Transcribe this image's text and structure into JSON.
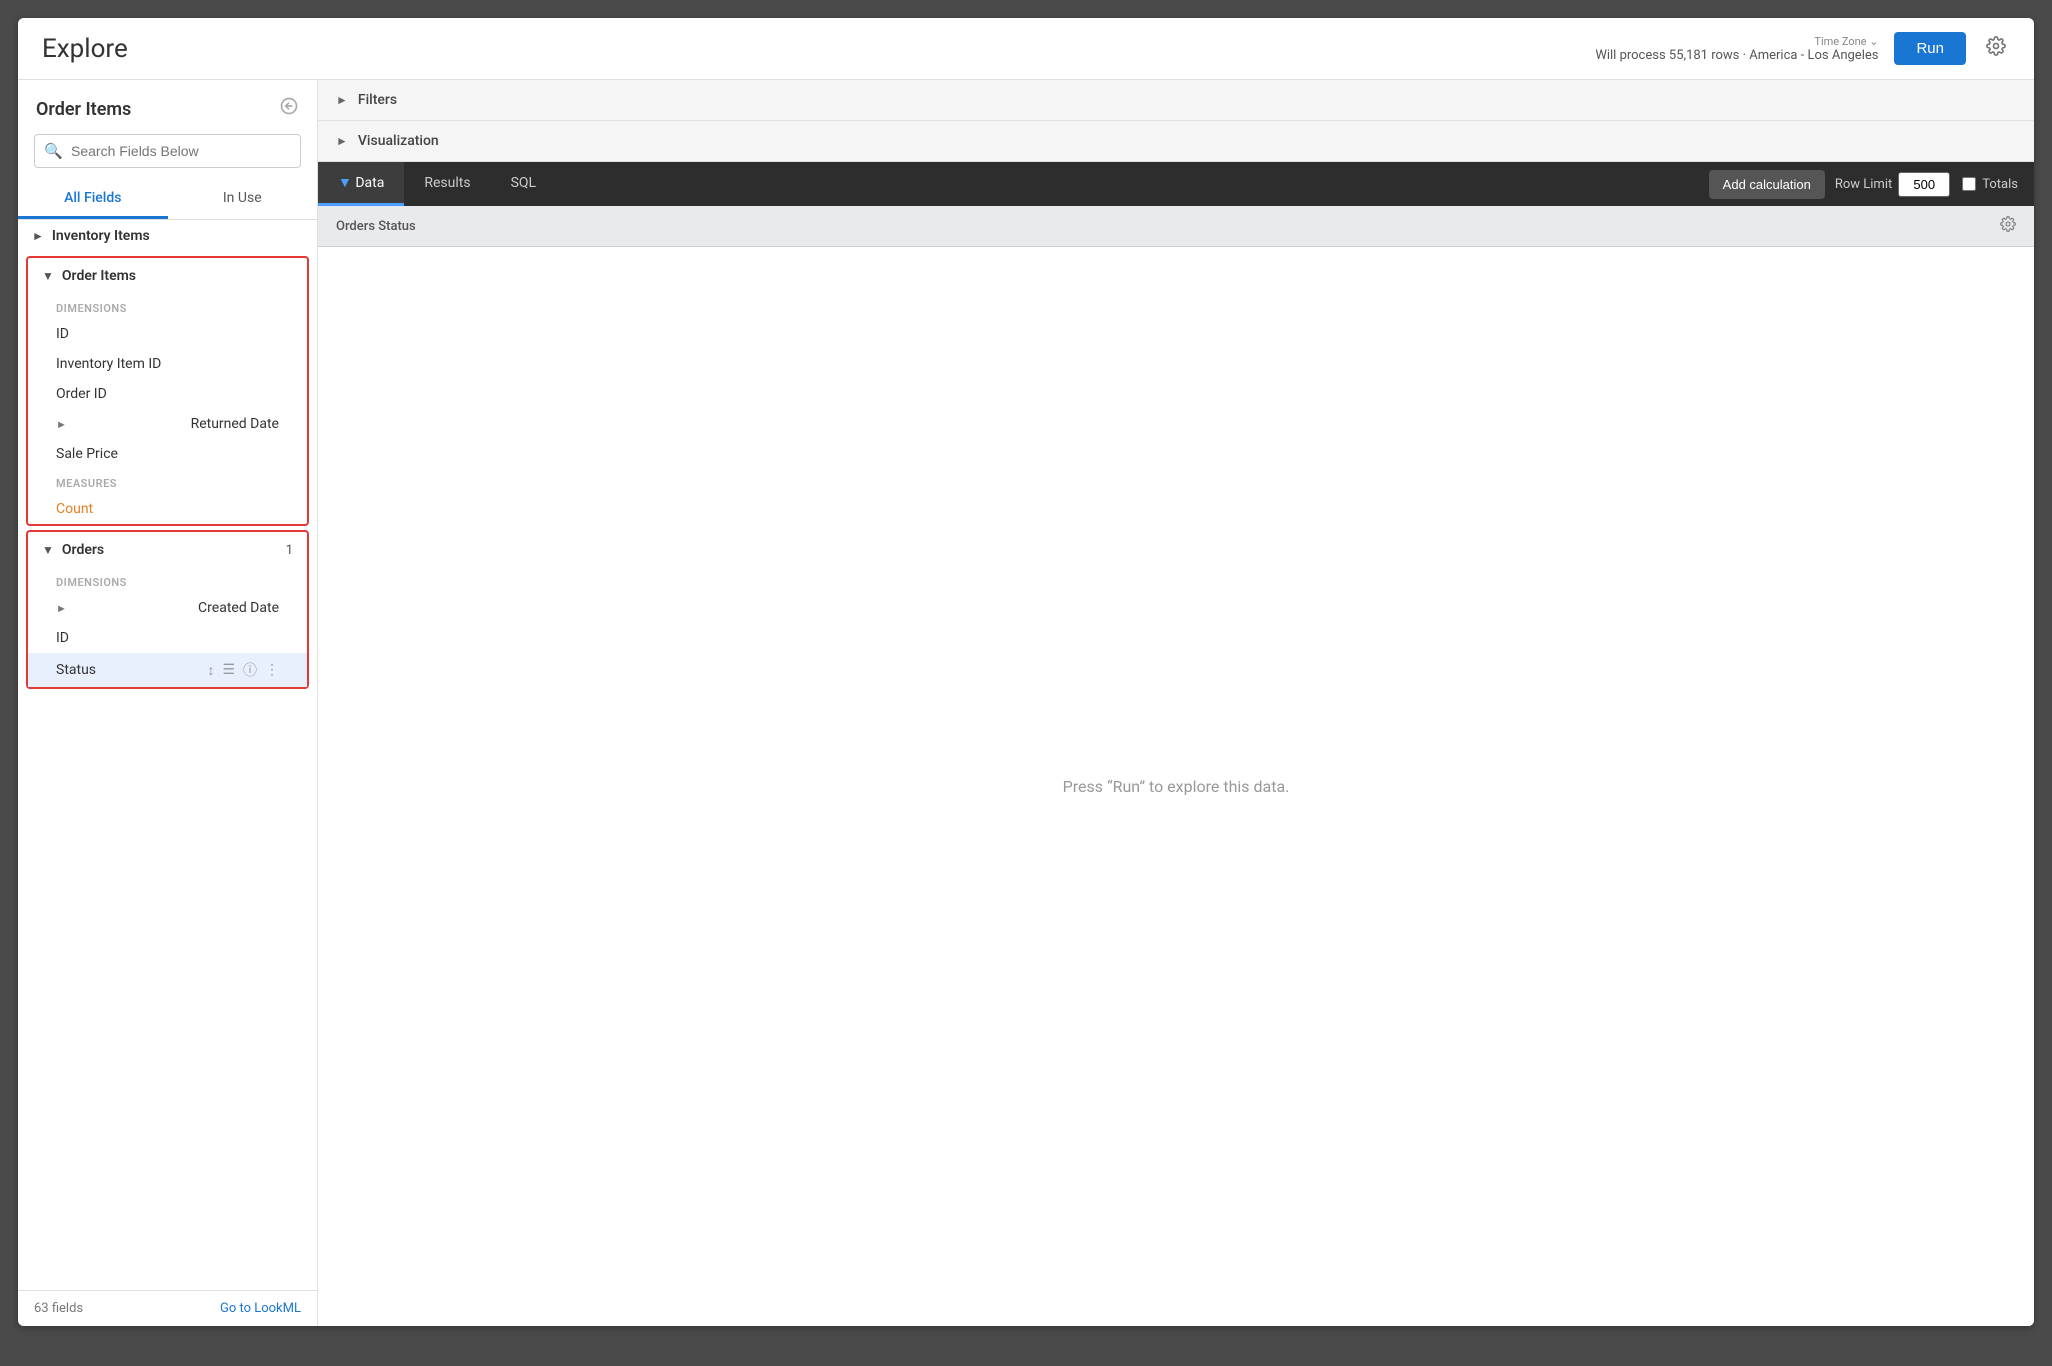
{
  "header": {
    "title": "Explore",
    "timezone_label": "Time Zone",
    "process_info": "Will process 55,181 rows · America - Los Angeles",
    "run_button_label": "Run"
  },
  "sidebar": {
    "title": "Order Items",
    "search_placeholder": "Search Fields Below",
    "tabs": [
      {
        "id": "all-fields",
        "label": "All Fields",
        "active": true
      },
      {
        "id": "in-use",
        "label": "In Use",
        "active": false
      }
    ],
    "groups": [
      {
        "id": "inventory-items",
        "label": "Inventory Items",
        "expanded": false,
        "highlighted": false,
        "count": null,
        "sections": []
      },
      {
        "id": "order-items",
        "label": "Order Items",
        "expanded": true,
        "highlighted": true,
        "count": null,
        "sections": [
          {
            "type": "dimensions",
            "label": "DIMENSIONS",
            "fields": [
              {
                "name": "ID",
                "expandable": false,
                "measure": false
              },
              {
                "name": "Inventory Item ID",
                "expandable": false,
                "measure": false
              },
              {
                "name": "Order ID",
                "expandable": false,
                "measure": false
              },
              {
                "name": "Returned Date",
                "expandable": true,
                "measure": false
              },
              {
                "name": "Sale Price",
                "expandable": false,
                "measure": false
              }
            ]
          },
          {
            "type": "measures",
            "label": "MEASURES",
            "fields": [
              {
                "name": "Count",
                "expandable": false,
                "measure": true
              }
            ]
          }
        ]
      },
      {
        "id": "orders",
        "label": "Orders",
        "expanded": true,
        "highlighted": true,
        "count": 1,
        "sections": [
          {
            "type": "dimensions",
            "label": "DIMENSIONS",
            "fields": [
              {
                "name": "Created Date",
                "expandable": true,
                "measure": false
              },
              {
                "name": "ID",
                "expandable": false,
                "measure": false
              },
              {
                "name": "Status",
                "expandable": false,
                "measure": false,
                "active": true
              }
            ]
          }
        ]
      }
    ],
    "footer": {
      "fields_count": "63 fields",
      "go_to_lookml": "Go to LookML"
    }
  },
  "right_panel": {
    "filters_label": "Filters",
    "visualization_label": "Visualization",
    "toolbar": {
      "tabs": [
        {
          "id": "data",
          "label": "Data",
          "active": true,
          "has_arrow": true
        },
        {
          "id": "results",
          "label": "Results",
          "active": false
        },
        {
          "id": "sql",
          "label": "SQL",
          "active": false
        }
      ],
      "add_calculation_label": "Add calculation",
      "row_limit_label": "Row Limit",
      "row_limit_value": "500",
      "totals_label": "Totals"
    },
    "results_column": "Orders Status",
    "empty_state_text": "Press “Run” to explore this data."
  }
}
